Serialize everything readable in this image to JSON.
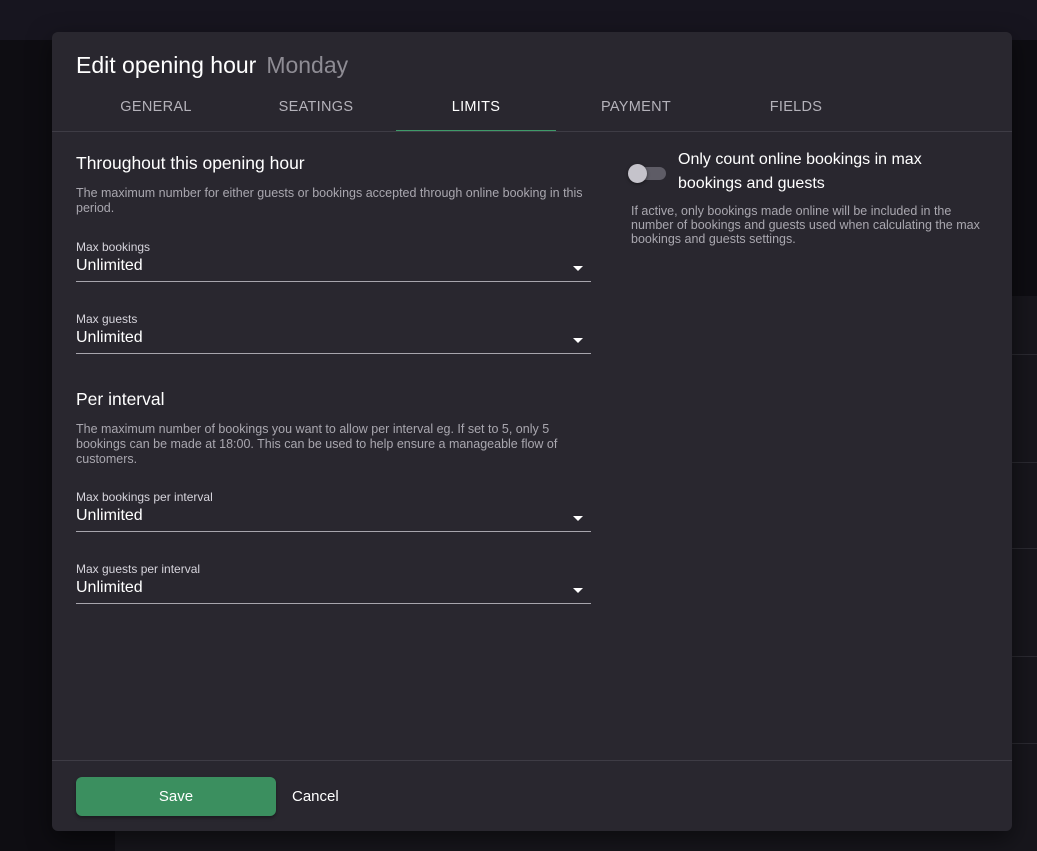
{
  "dialog": {
    "title": "Edit opening hour",
    "subtitle": "Monday"
  },
  "tabs": [
    {
      "label": "GENERAL",
      "active": false
    },
    {
      "label": "SEATINGS",
      "active": false
    },
    {
      "label": "LIMITS",
      "active": true
    },
    {
      "label": "PAYMENT",
      "active": false
    },
    {
      "label": "FIELDS",
      "active": false
    }
  ],
  "throughout": {
    "heading": "Throughout this opening hour",
    "description": "The maximum number for either guests or bookings accepted through online booking in this period.",
    "max_bookings": {
      "label": "Max bookings",
      "value": "Unlimited"
    },
    "max_guests": {
      "label": "Max guests",
      "value": "Unlimited"
    }
  },
  "per_interval": {
    "heading": "Per interval",
    "description": "The maximum number of bookings you want to allow per interval eg. If set to 5, only 5 bookings can be made at 18:00. This can be used to help ensure a manageable flow of customers.",
    "max_bookings": {
      "label": "Max bookings per interval",
      "value": "Unlimited"
    },
    "max_guests": {
      "label": "Max guests per interval",
      "value": "Unlimited"
    }
  },
  "online_toggle": {
    "label": "Only count online bookings in max bookings and guests",
    "description": "If active, only bookings made online will be included in the number of bookings and guests used when calculating the max bookings and guests settings.",
    "checked": false
  },
  "footer": {
    "save_label": "Save",
    "cancel_label": "Cancel"
  },
  "colors": {
    "accent": "#3f9a69",
    "save_button": "#3b8f5f",
    "dialog_bg": "#29272f"
  }
}
